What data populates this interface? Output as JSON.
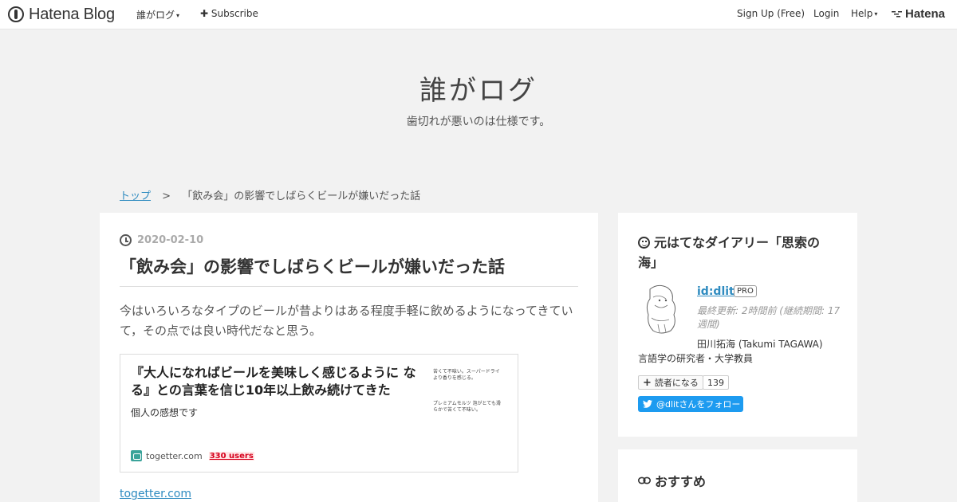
{
  "globalheader": {
    "logo_text": "Hatena Blog",
    "blog_menu": "誰がログ",
    "subscribe": "Subscribe",
    "signup": "Sign Up (Free)",
    "login": "Login",
    "help": "Help",
    "hatena": "Hatena"
  },
  "blog": {
    "title": "誰がログ",
    "description": "歯切れが悪いのは仕様です。"
  },
  "breadcrumb": {
    "top": "トップ",
    "separator": ">",
    "current": "「飲み会」の影響でしばらくビールが嫌いだった話"
  },
  "entry": {
    "date": "2020-02-10",
    "title": "「飲み会」の影響でしばらくビールが嫌いだった話",
    "body": "今はいろいろなタイプのビールが昔よりはある程度手軽に飲めるようになってきていて，その点では良い時代だなと思う。",
    "embed": {
      "title": "『大人になればビールを美味しく感じるように なる』との言葉を信じ10年以上飲み続けてきた",
      "description": "個人の感想です",
      "thumb_text_1": "苦くて不味い。スーパードライより香りを感じる。",
      "thumb_text_2": "プレミアムモルツ 泡がとても滑らかで苦くて不味い。",
      "site": "togetter.com",
      "users": "330 users"
    },
    "source_link": "togetter.com"
  },
  "sidebar": {
    "about": {
      "heading": "元はてなダイアリー「思索の海」",
      "id": "id:dlit",
      "badge": "PRO",
      "updated": "最終更新: 2時間前 (継続期間: 17週間)",
      "real_name": "田川拓海 (Takumi TAGAWA)",
      "description": "言語学の研究者・大学教員",
      "reader_button": "読者になる",
      "reader_count": "139",
      "twitter_follow": "@dlitさんをフォロー"
    },
    "recommend": {
      "heading": "おすすめ"
    }
  },
  "colors": {
    "link": "#2e8bc0",
    "twitter": "#1d9bf0",
    "users_badge": "#d6001c"
  }
}
